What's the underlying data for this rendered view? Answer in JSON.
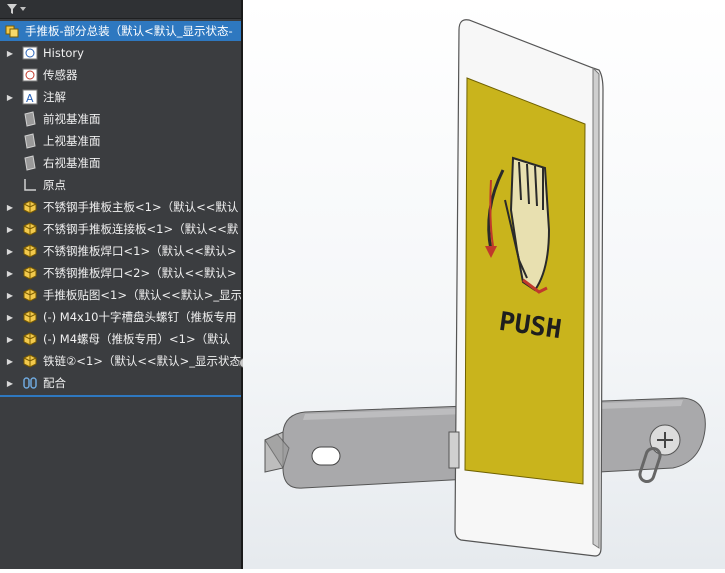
{
  "tree": {
    "root": "手推板-部分总装（默认<默认_显示状态-",
    "items": [
      {
        "label": "History",
        "expander": true
      },
      {
        "label": "传感器",
        "expander": false
      },
      {
        "label": "注解",
        "expander": true
      },
      {
        "label": "前视基准面",
        "expander": false
      },
      {
        "label": "上视基准面",
        "expander": false
      },
      {
        "label": "右视基准面",
        "expander": false
      },
      {
        "label": "原点",
        "expander": false
      },
      {
        "label": "不锈钢手推板主板<1>（默认<<默认",
        "expander": true
      },
      {
        "label": "不锈钢手推板连接板<1>（默认<<默",
        "expander": true
      },
      {
        "label": "不锈钢推板焊口<1>（默认<<默认>",
        "expander": true
      },
      {
        "label": "不锈钢推板焊口<2>（默认<<默认>",
        "expander": true
      },
      {
        "label": "手推板贴图<1>（默认<<默认>_显示",
        "expander": true
      },
      {
        "label": "(-) M4x10十字槽盘头螺钉（推板专用",
        "expander": true
      },
      {
        "label": "(-) M4螺母（推板专用）<1>（默认",
        "expander": true
      },
      {
        "label": "铁链②<1>（默认<<默认>_显示状态",
        "expander": true
      },
      {
        "label": "配合",
        "expander": true
      }
    ]
  },
  "model": {
    "sign_text": "PUSH",
    "colors": {
      "sign_yellow": "#c9b41c",
      "plate": "#f7f7f7",
      "arrow_red": "#c0392b"
    }
  }
}
